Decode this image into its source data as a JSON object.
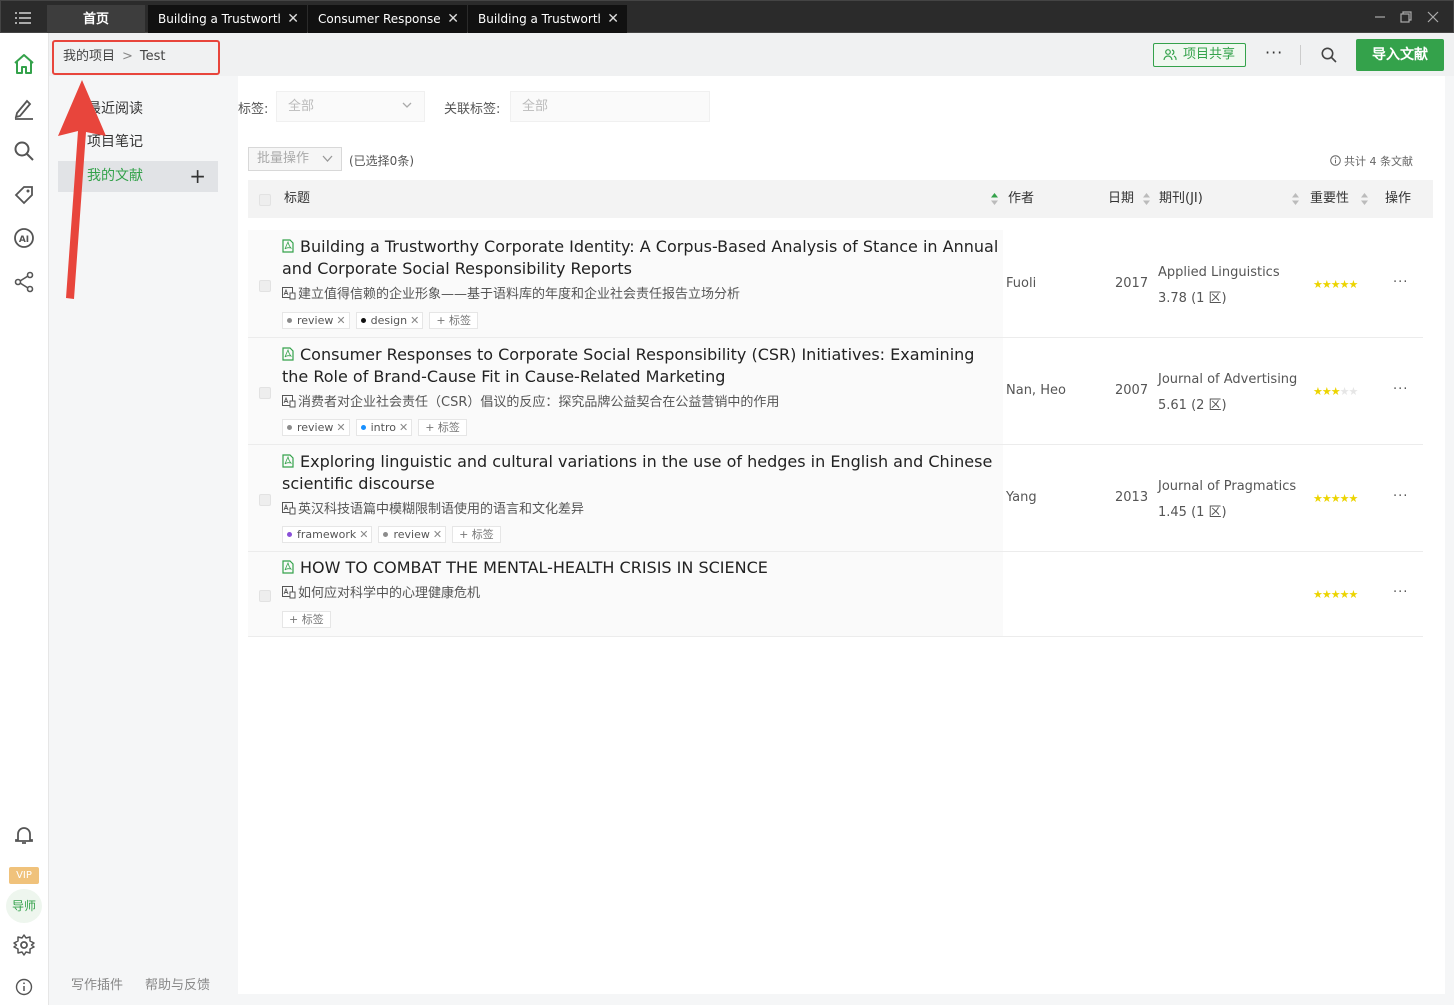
{
  "tabs": [
    {
      "label": "首页",
      "active": true
    },
    {
      "label": "Building a Trustworth..."
    },
    {
      "label": "Consumer Responses..."
    },
    {
      "label": "Building a Trustworth..."
    }
  ],
  "breadcrumb": {
    "root": "我的项目",
    "separator": ">",
    "current": "Test"
  },
  "header": {
    "share_label": "项目共享",
    "more_label": "···",
    "import_label": "导入文献"
  },
  "rail": {
    "vip_label": "VIP",
    "tutor_label": "导师"
  },
  "sidebar": {
    "items": [
      {
        "label": "最近阅读"
      },
      {
        "label": "项目笔记"
      },
      {
        "label": "我的文献"
      }
    ],
    "add_label": "+",
    "footer_plugin": "写作插件",
    "footer_help": "帮助与反馈"
  },
  "filters": {
    "tag_label": "标签:",
    "tag_value": "全部",
    "linked_label": "关联标签:",
    "linked_value": "全部"
  },
  "toolbar": {
    "batch_label": "批量操作",
    "selected_text": "(已选择0条)",
    "total_text": "共计 4 条文献"
  },
  "table": {
    "headers": {
      "title": "标题",
      "author": "作者",
      "date": "日期",
      "journal": "期刊(JI)",
      "importance": "重要性",
      "actions": "操作"
    },
    "add_tag_label": "+ 标签",
    "rows": [
      {
        "title": "Building a Trustworthy Corporate Identity: A Corpus-Based Analysis of Stance in Annual and Corporate Social Responsibility Reports",
        "subtitle": "建立值得信赖的企业形象——基于语料库的年度和企业社会责任报告立场分析",
        "tags": [
          {
            "name": "review",
            "color": "#8c8c8c"
          },
          {
            "name": "design",
            "color": "#111111"
          }
        ],
        "author": "Fuoli",
        "year": "2017",
        "journal": "Applied Linguistics",
        "impact": "3.78 (1 区)",
        "rating": 5,
        "more": "···"
      },
      {
        "title": "Consumer Responses to Corporate Social Responsibility (CSR) Initiatives: Examining the Role of Brand-Cause Fit in Cause-Related Marketing",
        "subtitle": "消费者对企业社会责任（CSR）倡议的反应：探究品牌公益契合在公益营销中的作用",
        "tags": [
          {
            "name": "review",
            "color": "#8c8c8c"
          },
          {
            "name": "intro",
            "color": "#1890ff"
          }
        ],
        "author": "Nan, Heo",
        "year": "2007",
        "journal": "Journal of Advertising",
        "impact": "5.61 (2 区)",
        "rating": 3,
        "more": "···"
      },
      {
        "title": "Exploring linguistic and cultural variations in the use of hedges in English and Chinese scientific discourse",
        "subtitle": "英汉科技语篇中模糊限制语使用的语言和文化差异",
        "tags": [
          {
            "name": "framework",
            "color": "#8a4fd8"
          },
          {
            "name": "review",
            "color": "#8c8c8c"
          }
        ],
        "author": "Yang",
        "year": "2013",
        "journal": "Journal of Pragmatics",
        "impact": "1.45 (1 区)",
        "rating": 5,
        "more": "···"
      },
      {
        "title": "HOW TO COMBAT THE MENTAL-HEALTH CRISIS IN SCIENCE",
        "subtitle": "如何应对科学中的心理健康危机",
        "tags": [],
        "author": "",
        "year": "",
        "journal": "",
        "impact": "",
        "rating": 5,
        "more": "···"
      }
    ]
  },
  "colors": {
    "accent": "#34a24b",
    "annotation": "#e8453c",
    "star": "#ecd400"
  }
}
